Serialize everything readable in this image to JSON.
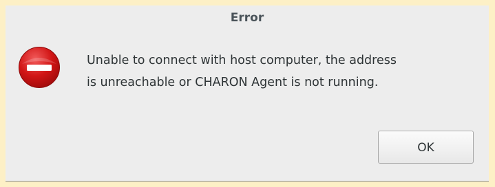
{
  "dialog": {
    "title": "Error",
    "icon": "error-stop-icon",
    "message_lines": [
      "Unable to connect with host computer, the address",
      "is unreachable or CHARON Agent is not running."
    ],
    "ok_label": "OK"
  },
  "colors": {
    "outer_background": "#fdf0c6",
    "dialog_background": "#ededed",
    "icon_red": "#d41616",
    "text": "#2e3436"
  }
}
